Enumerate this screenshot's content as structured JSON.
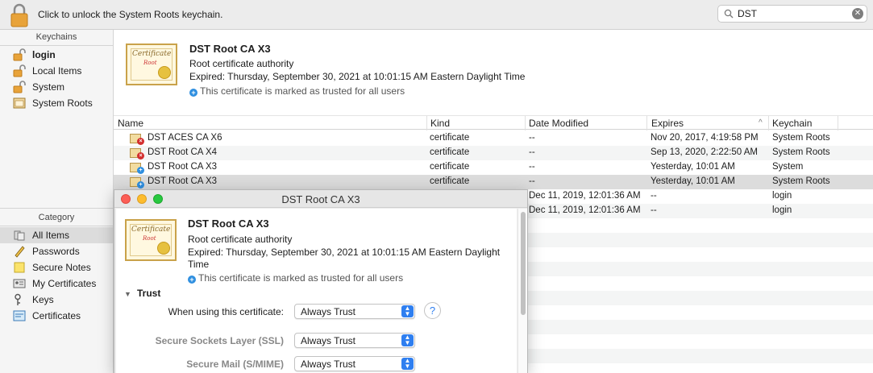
{
  "toolbar": {
    "message": "Click to unlock the System Roots keychain.",
    "search_value": "DST",
    "lock_icon": "lock-icon"
  },
  "sidebar": {
    "keychains_header": "Keychains",
    "keychains": [
      {
        "label": "login",
        "icon": "unlocked-lock-icon"
      },
      {
        "label": "Local Items",
        "icon": "unlocked-lock-icon"
      },
      {
        "label": "System",
        "icon": "unlocked-lock-icon"
      },
      {
        "label": "System Roots",
        "icon": "cabinet-icon"
      }
    ],
    "category_header": "Category",
    "categories": [
      {
        "label": "All Items",
        "icon": "all-items-icon"
      },
      {
        "label": "Passwords",
        "icon": "pencil-icon"
      },
      {
        "label": "Secure Notes",
        "icon": "note-icon"
      },
      {
        "label": "My Certificates",
        "icon": "id-card-icon"
      },
      {
        "label": "Keys",
        "icon": "key-icon"
      },
      {
        "label": "Certificates",
        "icon": "certificate-icon"
      }
    ]
  },
  "header": {
    "cert_text": "Certificate",
    "cert_subtext": "Root",
    "title": "DST Root CA X3",
    "subtitle": "Root certificate authority",
    "expired": "Expired: Thursday, September 30, 2021 at 10:01:15 AM Eastern Daylight Time",
    "trust_note": "This certificate is marked as trusted for all users"
  },
  "table": {
    "columns": [
      "Name",
      "Kind",
      "Date Modified",
      "Expires",
      "Keychain"
    ],
    "rows": [
      {
        "name": "DST ACES CA X6",
        "kind": "certificate",
        "modified": "--",
        "expires": "Nov 20, 2017, 4:19:58 PM",
        "keychain": "System Roots",
        "badge": "x"
      },
      {
        "name": "DST Root CA X4",
        "kind": "certificate",
        "modified": "--",
        "expires": "Sep 13, 2020, 2:22:50 AM",
        "keychain": "System Roots",
        "badge": "x"
      },
      {
        "name": "DST Root CA X3",
        "kind": "certificate",
        "modified": "--",
        "expires": "Yesterday, 10:01 AM",
        "keychain": "System",
        "badge": "+"
      },
      {
        "name": "DST Root CA X3",
        "kind": "certificate",
        "modified": "--",
        "expires": "Yesterday, 10:01 AM",
        "keychain": "System Roots",
        "badge": "+"
      },
      {
        "name": "",
        "kind": "",
        "modified": "Dec 11, 2019, 12:01:36 AM",
        "expires": "--",
        "keychain": "login",
        "badge": ""
      },
      {
        "name": "",
        "kind": "",
        "modified": "Dec 11, 2019, 12:01:36 AM",
        "expires": "--",
        "keychain": "login",
        "badge": ""
      }
    ]
  },
  "dialog": {
    "title": "DST Root CA X3",
    "cert_title": "DST Root CA X3",
    "cert_subtitle": "Root certificate authority",
    "expired_line1": "Expired: Thursday, September 30, 2021 at 10:01:15 AM Eastern Daylight",
    "expired_line2": "Time",
    "trust_note": "This certificate is marked as trusted for all users",
    "trust_section": "Trust",
    "when_using_label": "When using this certificate:",
    "when_using_value": "Always Trust",
    "ssl_label": "Secure Sockets Layer (SSL)",
    "ssl_value": "Always Trust",
    "smime_label": "Secure Mail (S/MIME)",
    "smime_value": "Always Trust",
    "help_label": "?"
  }
}
